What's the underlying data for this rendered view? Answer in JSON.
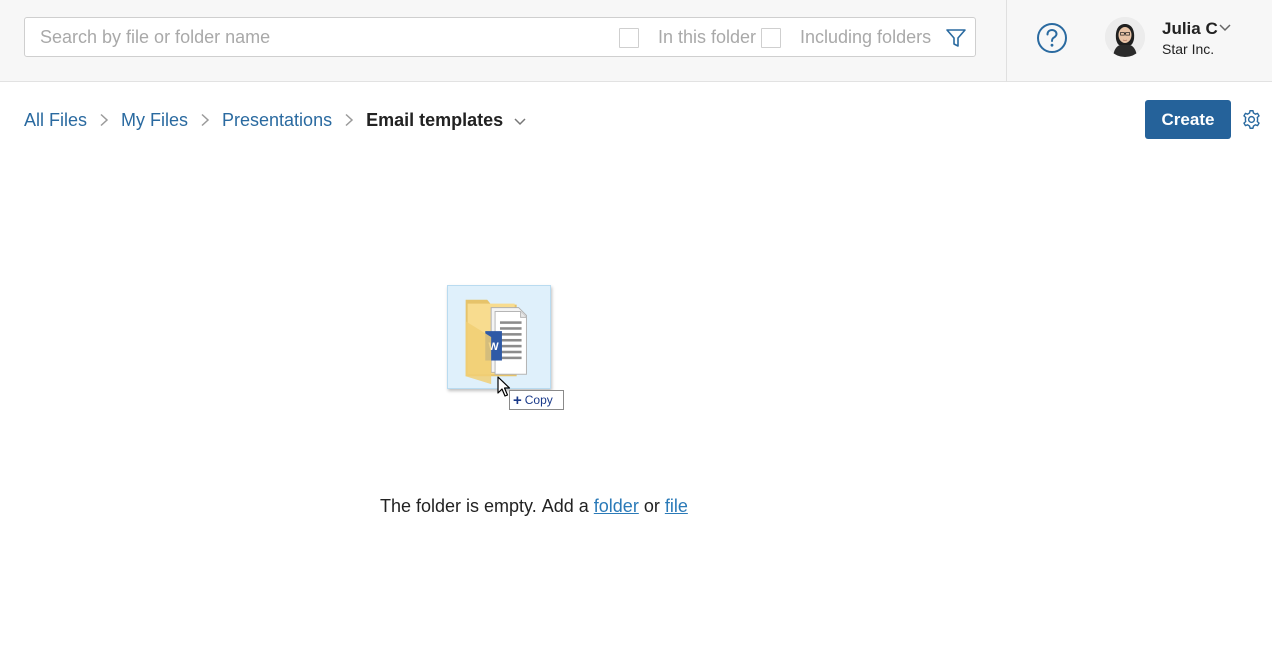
{
  "search": {
    "placeholder": "Search by file or folder name",
    "value": "",
    "option_in_folder": "In this folder",
    "option_including_folders": "Including folders"
  },
  "user": {
    "name": "Julia C",
    "company": "Star Inc."
  },
  "breadcrumb": {
    "items": [
      "All Files",
      "My Files",
      "Presentations"
    ],
    "current": "Email templates"
  },
  "toolbar": {
    "create_label": "Create"
  },
  "drag": {
    "tooltip_label": "Copy",
    "doc_badge": "W"
  },
  "empty_state": {
    "prefix": "The folder is empty. Add a ",
    "folder_link": "folder",
    "conjunction": " or ",
    "file_link": "file"
  },
  "colors": {
    "accent": "#25629a",
    "link": "#2a6aa0",
    "topbar_bg": "#f7f7f7"
  },
  "icons": [
    "filter-icon",
    "help-icon",
    "chevron-down-icon",
    "chevron-right-icon",
    "gear-icon",
    "folder-icon",
    "word-document-icon",
    "cursor-icon",
    "plus-icon"
  ]
}
